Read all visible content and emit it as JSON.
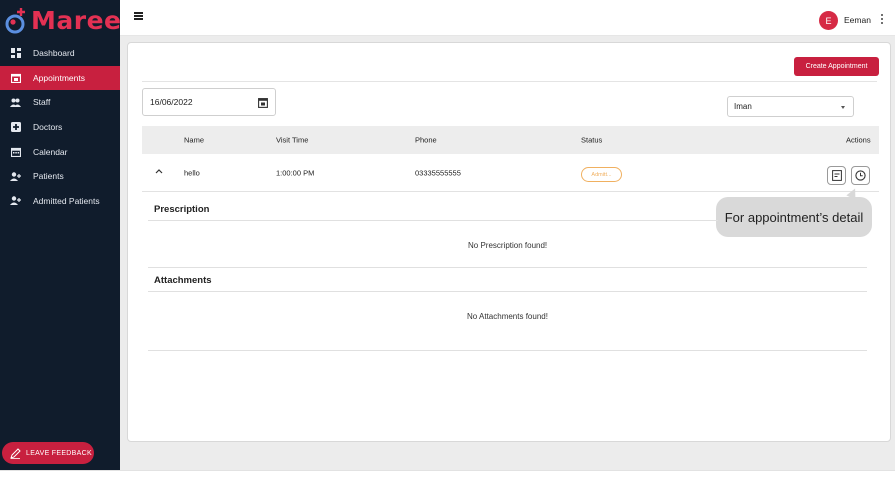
{
  "brand": {
    "name": "Mareez",
    "accent": "#c8203f",
    "sidebar_bg": "#101c2c"
  },
  "sidebar": {
    "items": [
      {
        "label": "Dashboard",
        "icon": "dashboard-icon"
      },
      {
        "label": "Appointments",
        "icon": "calendar-check-icon",
        "active": true
      },
      {
        "label": "Staff",
        "icon": "people-icon"
      },
      {
        "label": "Doctors",
        "icon": "medical-plus-icon"
      },
      {
        "label": "Calendar",
        "icon": "calendar-icon"
      },
      {
        "label": "Patients",
        "icon": "person-add-icon"
      },
      {
        "label": "Admitted Patients",
        "icon": "person-add-icon"
      }
    ],
    "feedback_label": "LEAVE FEEDBACK"
  },
  "header": {
    "avatar_letter": "E",
    "user_name": "Eeman"
  },
  "toolbar": {
    "create_label": "Create Appointment",
    "date_value": "16/06/2022",
    "doctor_select": "Iman"
  },
  "table": {
    "headers": {
      "name": "Name",
      "visit_time": "Visit Time",
      "phone": "Phone",
      "status": "Status",
      "actions": "Actions"
    },
    "rows": [
      {
        "name": "hello",
        "visit_time": "1:00:00 PM",
        "phone": "03335555555",
        "status": "Admitt..."
      }
    ]
  },
  "tooltip": "For appointment’s detail",
  "prescription": {
    "title": "Prescription",
    "empty": "No Prescription found!"
  },
  "attachments": {
    "title": "Attachments",
    "empty": "No Attachments found!"
  }
}
